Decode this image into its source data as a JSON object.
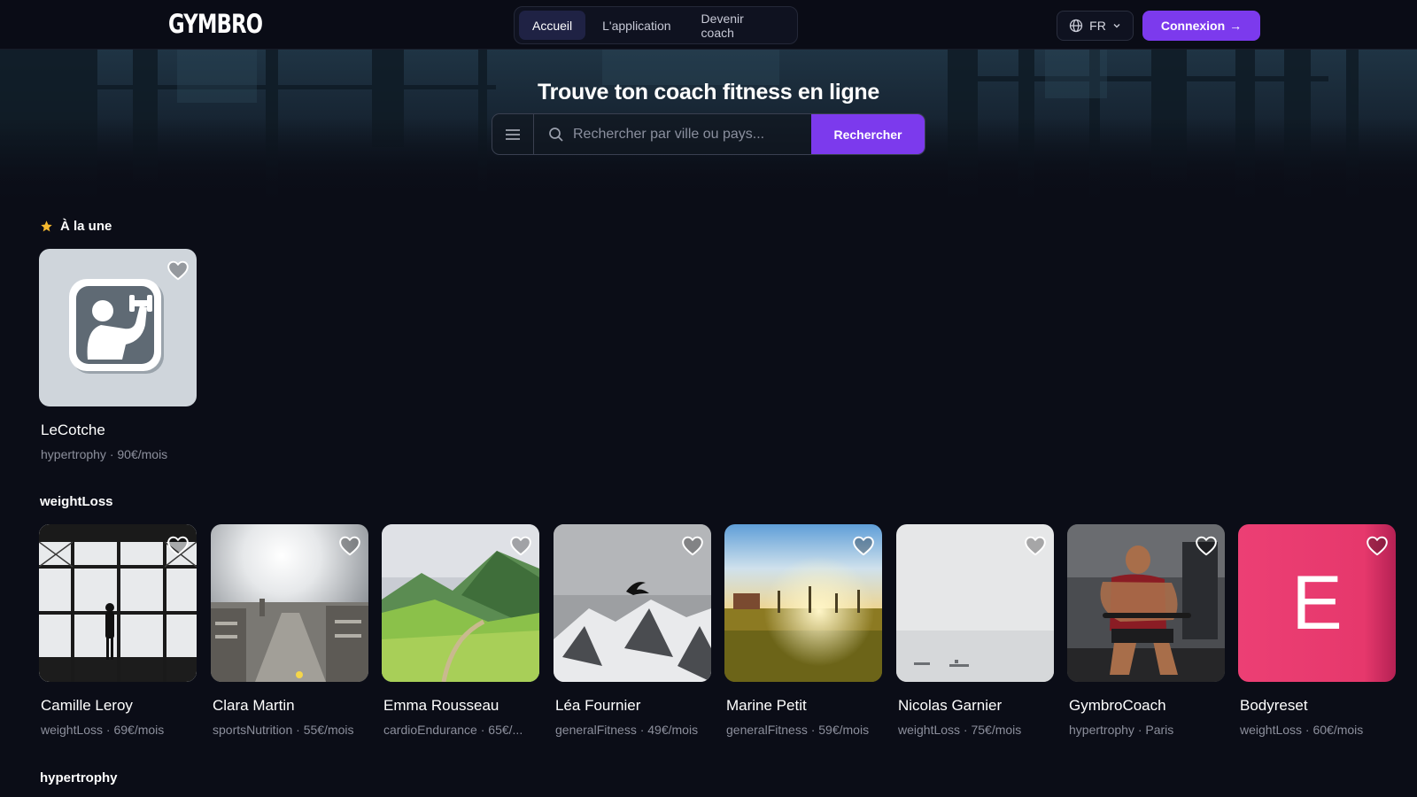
{
  "brand": {
    "logo": "GYMBRO"
  },
  "nav": {
    "items": [
      {
        "label": "Accueil",
        "active": true
      },
      {
        "label": "L'application",
        "active": false
      },
      {
        "label": "Devenir coach",
        "active": false
      }
    ]
  },
  "lang": {
    "code": "FR",
    "icon": "globe-icon"
  },
  "login": {
    "label": "Connexion",
    "arrow": "→"
  },
  "hero": {
    "title": "Trouve ton coach fitness en ligne",
    "search_placeholder": "Rechercher par ville ou pays...",
    "search_value": "",
    "search_button": "Rechercher"
  },
  "featured": {
    "title": "À la une",
    "icon": "star-icon",
    "cards": [
      {
        "name": "LeCotche",
        "meta": "hypertrophy · 90€/mois"
      }
    ]
  },
  "weightloss": {
    "title": "weightLoss",
    "cards": [
      {
        "name": "Camille Leroy",
        "meta": "weightLoss · 69€/mois"
      },
      {
        "name": "Clara Martin",
        "meta": "sportsNutrition · 55€/mois"
      },
      {
        "name": "Emma Rousseau",
        "meta": "cardioEndurance · 65€/..."
      },
      {
        "name": "Léa Fournier",
        "meta": "generalFitness · 49€/mois"
      },
      {
        "name": "Marine Petit",
        "meta": "generalFitness · 59€/mois"
      },
      {
        "name": "Nicolas Garnier",
        "meta": "weightLoss · 75€/mois"
      },
      {
        "name": "GymbroCoach",
        "meta": "hypertrophy · Paris"
      },
      {
        "name": "Bodyreset",
        "meta": "weightLoss · 60€/mois",
        "initial": "E"
      }
    ]
  },
  "hypertrophy": {
    "title": "hypertrophy"
  },
  "colors": {
    "accent": "#7c3aed",
    "star": "#f5b82e",
    "background": "#0b0d17"
  }
}
